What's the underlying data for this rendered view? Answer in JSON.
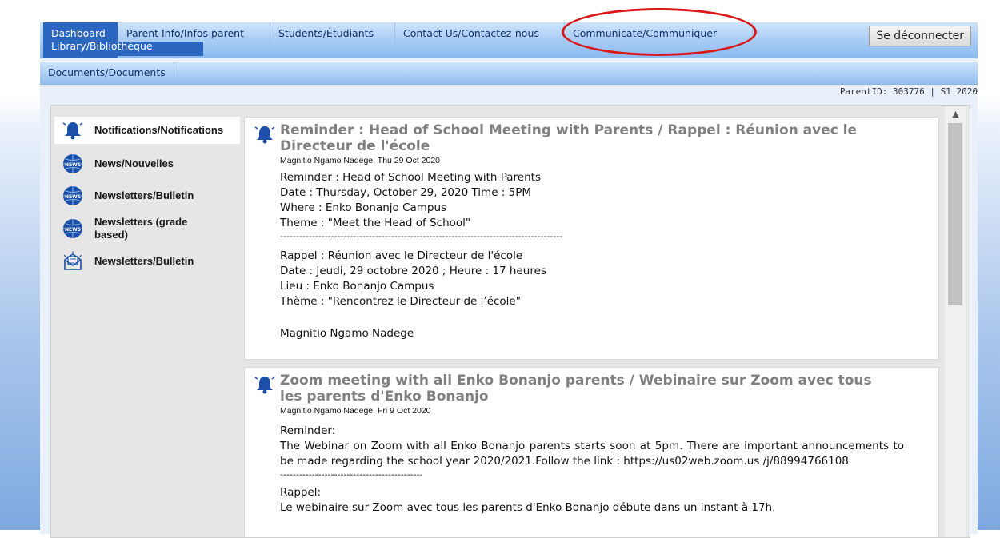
{
  "nav": {
    "dashboard": "Dashboard",
    "parent_info": "Parent Info/Infos parent",
    "library": "Library/Bibliothèque",
    "students": "Students/Étudiants",
    "contact": "Contact Us/Contactez-nous",
    "communicate": "Communicate/Communiquer",
    "logout": "Se déconnecter",
    "documents": "Documents/Documents"
  },
  "id_line": "ParentID: 303776 | S1 2020",
  "sidebar": {
    "items": [
      {
        "label": "Notifications/Notifications",
        "icon": "notification-icon"
      },
      {
        "label": "News/Nouvelles",
        "icon": "news-globe-icon"
      },
      {
        "label": "Newsletters/Bulletin",
        "icon": "news-globe-icon"
      },
      {
        "label": "Newsletters (grade based)",
        "icon": "news-globe-icon"
      },
      {
        "label": "Newsletters/Bulletin",
        "icon": "newsletter-envelope-icon"
      }
    ]
  },
  "posts": [
    {
      "title": "Reminder : Head of School Meeting with Parents / Rappel : Réunion avec le Directeur de l'école",
      "meta": "Magnitio Ngamo Nadege, Thu 29 Oct 2020",
      "lines": [
        "Reminder : Head of School Meeting with Parents",
        "Date : Thursday, October 29, 2020 Time : 5PM",
        "Where : Enko Bonanjo Campus",
        "Theme : \"Meet the Head of School\"",
        "-----------------------------------------------------------------------------------------",
        "Rappel : Réunion avec le Directeur de l'école",
        "Date : Jeudi, 29 octobre 2020 ; Heure : 17 heures",
        "Lieu : Enko Bonanjo Campus",
        "Thème : \"Rencontrez le Directeur de l’école\"",
        "",
        "Magnitio Ngamo Nadege"
      ]
    },
    {
      "title": "Zoom meeting with all Enko Bonanjo parents / Webinaire sur Zoom avec tous les parents d'Enko Bonanjo",
      "meta": "Magnitio Ngamo Nadege, Fri 9 Oct 2020",
      "reminder_label": "Reminder:",
      "paragraph": "The Webinar on Zoom with all Enko Bonanjo parents starts soon at 5pm. There are important announcements to be made regarding the school year 2020/2021.Follow the link : https://us02web.zoom.us /j/88994766108",
      "separator": "---------------------------------------------",
      "rappel_label": "Rappel:",
      "rappel_text": "Le webinaire sur Zoom avec tous les parents d'Enko Bonanjo débute dans un instant à 17h."
    }
  ],
  "colors": {
    "nav_active": "#2b67c0",
    "highlight_ellipse": "#d71919",
    "title_gray": "#7f7f7f"
  }
}
